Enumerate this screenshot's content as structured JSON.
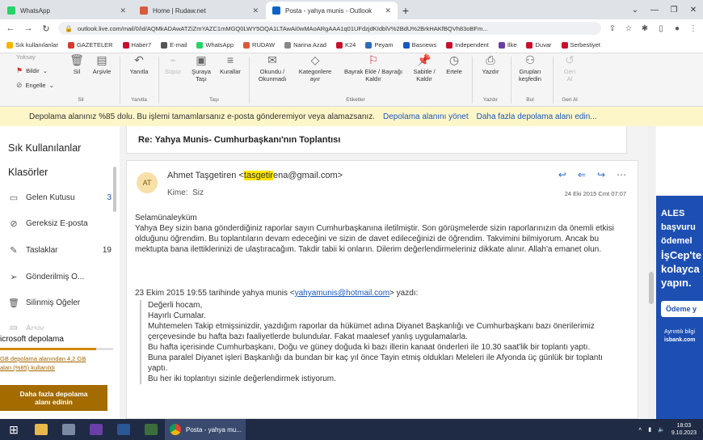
{
  "browser": {
    "tabs": [
      {
        "label": "WhatsApp",
        "icon": "whatsapp-icon",
        "color": "#25d366"
      },
      {
        "label": "Home | Rudaw.net",
        "icon": "rudaw-icon",
        "color": "#d85a3a"
      },
      {
        "label": "Posta - yahya munis - Outlook",
        "icon": "outlook-icon",
        "color": "#0a64c8"
      }
    ],
    "url": "outlook.live.com/mail/0/id/AQMkADAwATZiZmYAZC1mMGQ0LWY5OQA1LTAwAi0wMAoARgAAA1q01UFdzjdKIdblV%2BdU%2BrkHAKfBQVh83oBFm..."
  },
  "bookmarks": [
    {
      "label": "Sık kullanılanlar",
      "color": "#f5b400"
    },
    {
      "label": "GAZETELER",
      "color": "#d63b2f"
    },
    {
      "label": "Haber7",
      "color": "#c8102e"
    },
    {
      "label": "E-mail",
      "color": "#555555"
    },
    {
      "label": "WhatsApp",
      "color": "#25d366"
    },
    {
      "label": "RUDAW",
      "color": "#d85a3a"
    },
    {
      "label": "Narina Azad",
      "color": "#888888"
    },
    {
      "label": "K24",
      "color": "#c8102e"
    },
    {
      "label": "Peyam",
      "color": "#2a6db5"
    },
    {
      "label": "Basnews",
      "color": "#1a56c2"
    },
    {
      "label": "Independent",
      "color": "#c8102e"
    },
    {
      "label": "İlke",
      "color": "#6b3fa0"
    },
    {
      "label": "Duvar",
      "color": "#c8102e"
    },
    {
      "label": "Serbestiyet",
      "color": "#c8102e"
    }
  ],
  "ribbon": {
    "partial_top": "Yoksay",
    "report": "Bildir",
    "block": "Engelle",
    "delete": "Sil",
    "archive": "Arşivle",
    "reply": "Yanıtla",
    "sweep": "Süpür",
    "move_to": "Şuraya\nTaşı",
    "rules": "Kurallar",
    "read_unread": "Okundu /\nOkunmadı",
    "categorize": "Kategorilere\nayır",
    "flag": "Bayrak Ekle / Bayrağı\nKaldır",
    "pin": "Sabitle /\nKaldır",
    "snooze": "Ertele",
    "print": "Yazdır",
    "discover_groups": "Grupları\nkeşfedin",
    "undo": "Geri\nAl",
    "groups": {
      "delete": "Sil",
      "respond": "Yanıtla",
      "move": "Taşı",
      "tags": "Etiketler",
      "print": "Yazdır",
      "find": "Bul",
      "undo": "Geri Al"
    }
  },
  "warning": {
    "text": "Depolama alanınız %85 dolu. Bu işlemi tamamlarsanız e-posta gönderemiyor veya alamazsanız.",
    "link1": "Depolama alanını yönet",
    "link2": "Daha fazla depolama alanı edin..."
  },
  "sidebar": {
    "favorites": "Sık Kullanılanlar",
    "folders": "Klasörler",
    "items": [
      {
        "label": "Gelen Kutusu",
        "count": "3",
        "icon": "inbox-icon"
      },
      {
        "label": "Gereksiz E-posta",
        "count": "",
        "icon": "junk-icon"
      },
      {
        "label": "Taslaklar",
        "count": "19",
        "icon": "drafts-icon"
      },
      {
        "label": "Gönderilmiş Ö...",
        "count": "",
        "icon": "sent-icon"
      },
      {
        "label": "Silinmiş Öğeler",
        "count": "",
        "icon": "trash-icon"
      },
      {
        "label": "Arşiv",
        "count": "",
        "icon": "archive-icon"
      }
    ],
    "storage": {
      "title": "icrosoft depolama",
      "desc": "GB depolama alanından 4,2 GB\nalan (%85) kullanıldı",
      "used_fraction": 0.85,
      "button": "Daha fazla depolama\nalanı edinin"
    }
  },
  "message": {
    "subject": "Re: Yahya Munis- Cumhurbaşkanı'nın Toplantısı",
    "avatar": "AT",
    "sender_name": "Ahmet Taşgetiren <",
    "sender_highlight": "tasgetir",
    "sender_rest": "ena@gmail.com>",
    "to_label": "Kime:",
    "to_value": "Siz",
    "date": "24 Eki 2015 Cmt 07:07",
    "body": [
      "Selamünaleyküm",
      "Yahya Bey sizin bana gönderdiğiniz raporlar sayın Cumhurbaşkanına iletilmiştir. Son görüşmelerde sizin raporlarınızın da önemli etkisi olduğunu öğrendim. Bu toplantıların devam edeceğini ve sizin de davet edileceğinizi de öğrendim. Takvimini bilmiyorum. Ancak bu mektupta bana ilettiklerinizi de ulaştıracağım. Takdir tabii ki onların. Dilerim değerlendirmeleriniz dikkate alınır. Allah'a emanet olun."
    ],
    "quote_head_prefix": "23 Ekim 2015 19:55 tarihinde yahya munis <",
    "quote_head_link": "yahyamunis@hotmail.com",
    "quote_head_suffix": "> yazdı:",
    "quote": [
      "Değerli hocam,",
      "Hayırlı Cumalar.",
      "Muhtemelen Takip etmişsinizdir, yazdığım raporlar da hükümet adına Diyanet Başkanlığı ve Cumhurbaşkanı bazı önerilerimiz çerçevesinde bu  hafta bazı faaliyetlerde bulundular. Fakat maalesef yanlış uygulamalarla.",
      "Bu hafta içerisinde Cumhurbaşkanı, Doğu ve güney doğuda ki bazı illerin kanaat önderleri ile 10.30 saat'lik bir toplantı yaptı.",
      "Buna paralel Diyanet işleri Başkanlığı da bundan bir kaç yıl önce Tayin etmiş oldukları Meleleri ile Afyonda üç günlük bir toplantı yaptı.",
      "Bu her iki toplantıyı sizinle değerlendirmek istiyorum."
    ]
  },
  "ad": {
    "lines": [
      "ALES",
      "başvuru",
      "ödemel",
      "İşCep'te",
      "kolayca",
      "yapın."
    ],
    "button": "Ödeme y",
    "small1": "Ayrıntılı bilgi",
    "small2": "isbank.com"
  },
  "taskbar": {
    "chrome_label": "Posta - yahya mu...",
    "time": "18:03",
    "date": "9.10.2023"
  }
}
